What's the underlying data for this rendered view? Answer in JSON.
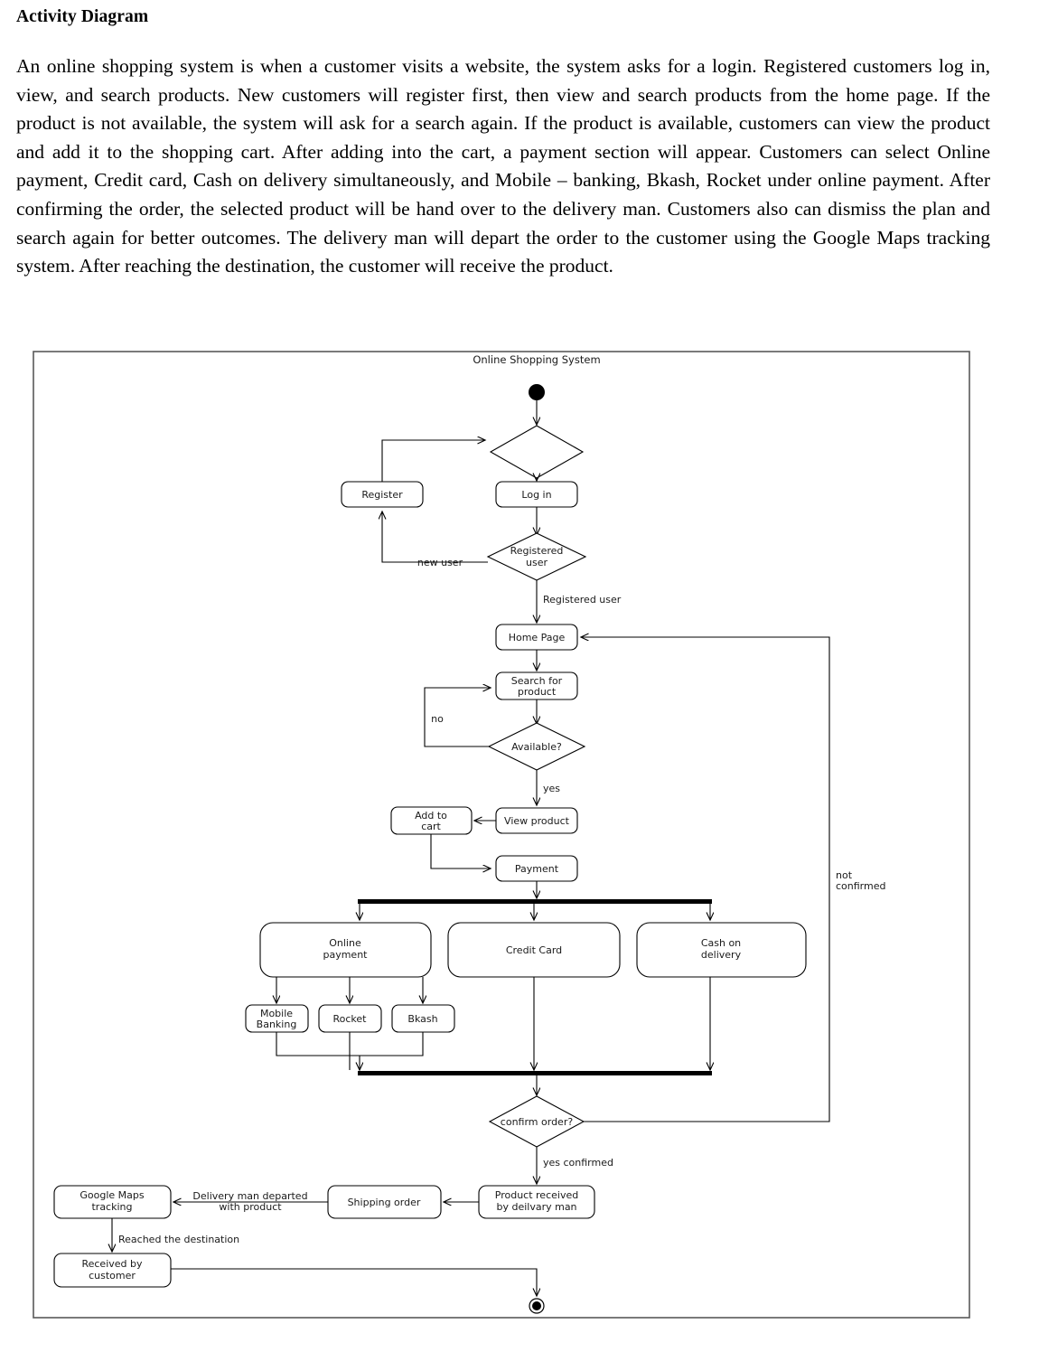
{
  "document": {
    "heading": "Activity Diagram",
    "paragraph": "An online shopping system is when a customer visits a website, the system asks for a login. Registered customers log in, view, and search products. New customers will register first, then view and search products from the home page. If the product is not available, the system will ask for a search again. If the product is available, customers can view the product and add it to the shopping cart. After adding into the cart, a payment section will appear. Customers can select Online payment, Credit card, Cash on delivery simultaneously, and Mobile – banking, Bkash, Rocket under online payment. After confirming the order, the selected product will be hand over to the delivery man. Customers also can dismiss the plan and search again for better outcomes. The delivery man will depart the order to the customer using the Google Maps tracking system. After reaching the destination, the customer will receive the product."
  },
  "diagram": {
    "frame_title": "Online Shopping System",
    "colors": {
      "stroke": "#000000",
      "frame_stroke": "#595959",
      "fill": "#ffffff",
      "text": "#1a1a1a"
    },
    "nodes": {
      "start": "start-node",
      "login_decision": "",
      "register": "Register",
      "log_in": "Log in",
      "registered_user_decision_line1": "Registered",
      "registered_user_decision_line2": "user",
      "home_page": "Home Page",
      "search_line1": "Search for",
      "search_line2": "product",
      "available_decision": "Available?",
      "add_to_cart_line1": "Add to",
      "add_to_cart_line2": "cart",
      "view_product": "View product",
      "payment": "Payment",
      "online_payment_line1": "Online",
      "online_payment_line2": "payment",
      "credit_card": "Credit Card",
      "cash_on_delivery_line1": "Cash on",
      "cash_on_delivery_line2": "delivery",
      "mobile_banking_line1": "Mobile",
      "mobile_banking_line2": "Banking",
      "rocket": "Rocket",
      "bkash": "Bkash",
      "confirm_order_decision": "confirm order?",
      "product_received_line1": "Product received",
      "product_received_line2": "by deilvary man",
      "shipping_order": "Shipping order",
      "google_maps_line1": "Google Maps",
      "google_maps_line2": "tracking",
      "received_by_customer_line1": "Received by",
      "received_by_customer_line2": "customer",
      "end": "end-node"
    },
    "edge_labels": {
      "new_user": "new user",
      "registered_user": "Registered user",
      "no": "no",
      "yes": "yes",
      "not_confirmed_line1": "not",
      "not_confirmed_line2": "confirmed",
      "yes_confirmed": "yes confirmed",
      "delivery_man_line1": "Delivery man departed",
      "delivery_man_line2": "with product",
      "reached_destination": "Reached the destination"
    }
  }
}
